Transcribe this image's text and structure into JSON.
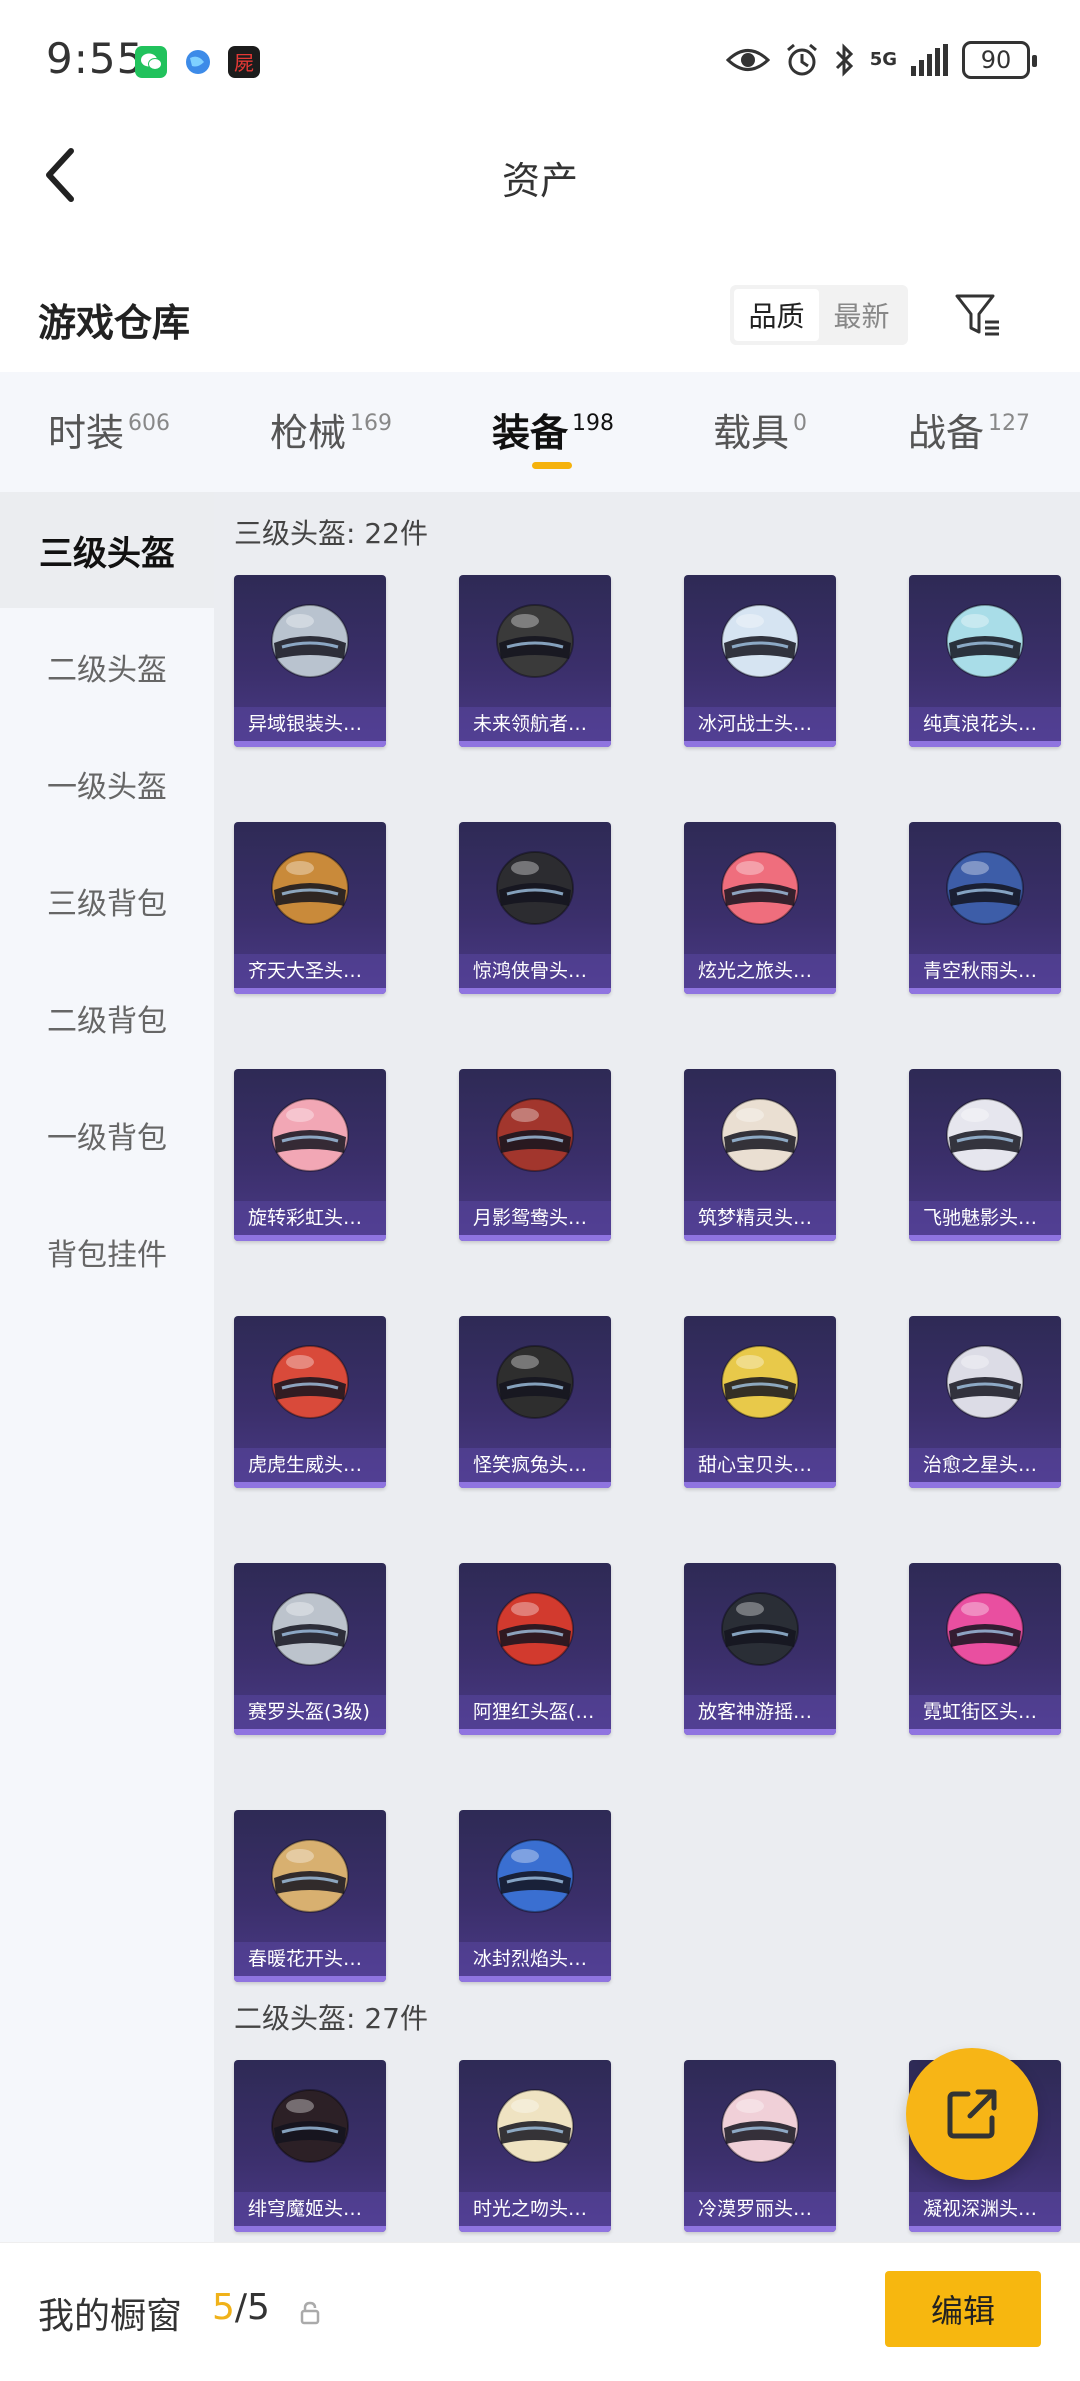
{
  "status_bar": {
    "time": "9:55",
    "battery": "90",
    "network": "5G",
    "icons": [
      "wechat-icon",
      "globe-icon",
      "game-app-icon",
      "eye-icon",
      "alarm-icon",
      "bluetooth-icon",
      "signal-icon",
      "battery-icon"
    ]
  },
  "nav": {
    "title": "资产",
    "back_icon": "chevron-left-icon"
  },
  "warehouse": {
    "title": "游戏仓库",
    "sort_options": [
      "品质",
      "最新"
    ],
    "sort_selected": "品质",
    "filter_icon": "filter-icon"
  },
  "tabs": [
    {
      "label": "时装",
      "count": "606"
    },
    {
      "label": "枪械",
      "count": "169"
    },
    {
      "label": "装备",
      "count": "198",
      "active": true
    },
    {
      "label": "载具",
      "count": "0"
    },
    {
      "label": "战备",
      "count": "127"
    }
  ],
  "sidebar": {
    "items": [
      {
        "label": "三级头盔",
        "active": true
      },
      {
        "label": "二级头盔"
      },
      {
        "label": "一级头盔"
      },
      {
        "label": "三级背包"
      },
      {
        "label": "二级背包"
      },
      {
        "label": "一级背包"
      },
      {
        "label": "背包挂件"
      }
    ]
  },
  "sections": [
    {
      "title": "三级头盔: 22件",
      "items": [
        {
          "name": "异域银装头…",
          "color": "#b9c3cf"
        },
        {
          "name": "未来领航者…",
          "color": "#3a3a3a"
        },
        {
          "name": "冰河战士头…",
          "color": "#d6e4f2"
        },
        {
          "name": "纯真浪花头…",
          "color": "#a9dde8"
        },
        {
          "name": "齐天大圣头…",
          "color": "#c98a3a"
        },
        {
          "name": "惊鸿侠骨头…",
          "color": "#2c2c30"
        },
        {
          "name": "炫光之旅头…",
          "color": "#ef6e7d"
        },
        {
          "name": "青空秋雨头…",
          "color": "#3d5da8"
        },
        {
          "name": "旋转彩虹头…",
          "color": "#f2a7b5"
        },
        {
          "name": "月影鸳鸯头…",
          "color": "#a2362d"
        },
        {
          "name": "筑梦精灵头…",
          "color": "#eadfd2"
        },
        {
          "name": "飞驰魅影头…",
          "color": "#e6e6ee"
        },
        {
          "name": "虎虎生威头…",
          "color": "#d94a3a"
        },
        {
          "name": "怪笑疯兔头…",
          "color": "#2e2e2e"
        },
        {
          "name": "甜心宝贝头…",
          "color": "#e8c94a"
        },
        {
          "name": "治愈之星头…",
          "color": "#dcdce6"
        },
        {
          "name": "赛罗头盔(3级)",
          "color": "#bcc3cc"
        },
        {
          "name": "阿狸红头盔(…",
          "color": "#d23a2e"
        },
        {
          "name": "放客神游摇…",
          "color": "#2a2e36"
        },
        {
          "name": "霓虹街区头…",
          "color": "#e94fa0"
        },
        {
          "name": "春暖花开头…",
          "color": "#d8b070"
        },
        {
          "name": "冰封烈焰头…",
          "color": "#3a6fd1"
        }
      ]
    },
    {
      "title": "二级头盔: 27件",
      "items": [
        {
          "name": "绯穹魔姬头…",
          "color": "#2c2026"
        },
        {
          "name": "时光之吻头…",
          "color": "#efe3c2"
        },
        {
          "name": "冷漠罗丽头…",
          "color": "#f0d0d8"
        },
        {
          "name": "凝视深渊头…",
          "color": "#58607a"
        }
      ]
    }
  ],
  "fab": {
    "icon": "share-external-icon"
  },
  "bottom_bar": {
    "label": "我的橱窗",
    "count_current": "5",
    "count_separator": "/",
    "count_total": "5",
    "lock_icon": "lock-icon",
    "edit_label": "编辑"
  },
  "colors": {
    "accent": "#f7b70f",
    "tab_underline": "#f5b20c",
    "card_bg": "#3b2f6b"
  }
}
